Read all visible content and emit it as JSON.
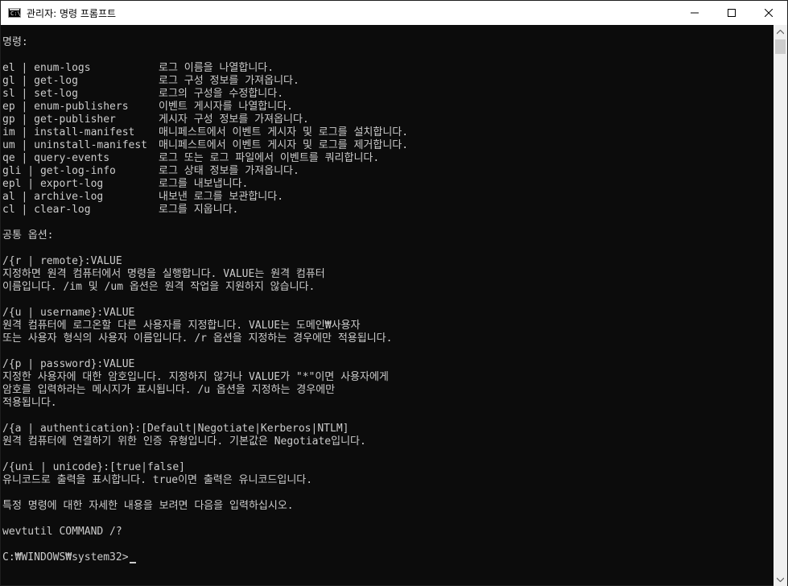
{
  "window": {
    "title": "관리자: 명령 프롬프트",
    "icon_name": "cmd-icon",
    "icon_text": "C:\\"
  },
  "controls": {
    "minimize_icon": "minimize-icon",
    "maximize_icon": "maximize-icon",
    "close_icon": "close-icon"
  },
  "console": {
    "commands_heading": "명령:",
    "commands": [
      {
        "name": "el | enum-logs",
        "desc": "로그 이름을 나열합니다."
      },
      {
        "name": "gl | get-log",
        "desc": "로그 구성 정보를 가져옵니다."
      },
      {
        "name": "sl | set-log",
        "desc": "로그의 구성을 수정합니다."
      },
      {
        "name": "ep | enum-publishers",
        "desc": "이벤트 게시자를 나열합니다."
      },
      {
        "name": "gp | get-publisher",
        "desc": "게시자 구성 정보를 가져옵니다."
      },
      {
        "name": "im | install-manifest",
        "desc": "매니페스트에서 이벤트 게시자 및 로그를 설치합니다."
      },
      {
        "name": "um | uninstall-manifest",
        "desc": "매니페스트에서 이벤트 게시자 및 로그를 제거합니다."
      },
      {
        "name": "qe | query-events",
        "desc": "로그 또는 로그 파일에서 이벤트를 쿼리합니다."
      },
      {
        "name": "gli | get-log-info",
        "desc": "로그 상태 정보를 가져옵니다."
      },
      {
        "name": "epl | export-log",
        "desc": "로그를 내보냅니다."
      },
      {
        "name": "al | archive-log",
        "desc": "내보낸 로그를 보관합니다."
      },
      {
        "name": "cl | clear-log",
        "desc": "로그를 지웁니다."
      }
    ],
    "options_heading": "공통 옵션:",
    "options": [
      {
        "flag": "/{r | remote}:VALUE",
        "lines": [
          "지정하면 원격 컴퓨터에서 명령을 실행합니다. VALUE는 원격 컴퓨터",
          "이름입니다. /im 및 /um 옵션은 원격 작업을 지원하지 않습니다."
        ]
      },
      {
        "flag": "/{u | username}:VALUE",
        "lines": [
          "원격 컴퓨터에 로그온할 다른 사용자를 지정합니다. VALUE는 도메인₩사용자",
          "또는 사용자 형식의 사용자 이름입니다. /r 옵션을 지정하는 경우에만 적용됩니다."
        ]
      },
      {
        "flag": "/{p | password}:VALUE",
        "lines": [
          "지정한 사용자에 대한 암호입니다. 지정하지 않거나 VALUE가 \"*\"이면 사용자에게",
          "암호를 입력하라는 메시지가 표시됩니다. /u 옵션을 지정하는 경우에만",
          "적용됩니다."
        ]
      },
      {
        "flag": "/{a | authentication}:[Default|Negotiate|Kerberos|NTLM]",
        "lines": [
          "원격 컴퓨터에 연결하기 위한 인증 유형입니다. 기본값은 Negotiate입니다."
        ]
      },
      {
        "flag": "/{uni | unicode}:[true|false]",
        "lines": [
          "유니코드로 출력을 표시합니다. true이면 출력은 유니코드입니다."
        ]
      }
    ],
    "help_hint": "특정 명령에 대한 자세한 내용을 보려면 다음을 입력하십시오.",
    "help_command": "wevtutil COMMAND /?",
    "prompt": "C:₩WINDOWS₩system32>"
  },
  "scrollbar": {
    "up_icon": "scroll-up-arrow-icon",
    "down_icon": "scroll-down-arrow-icon"
  }
}
